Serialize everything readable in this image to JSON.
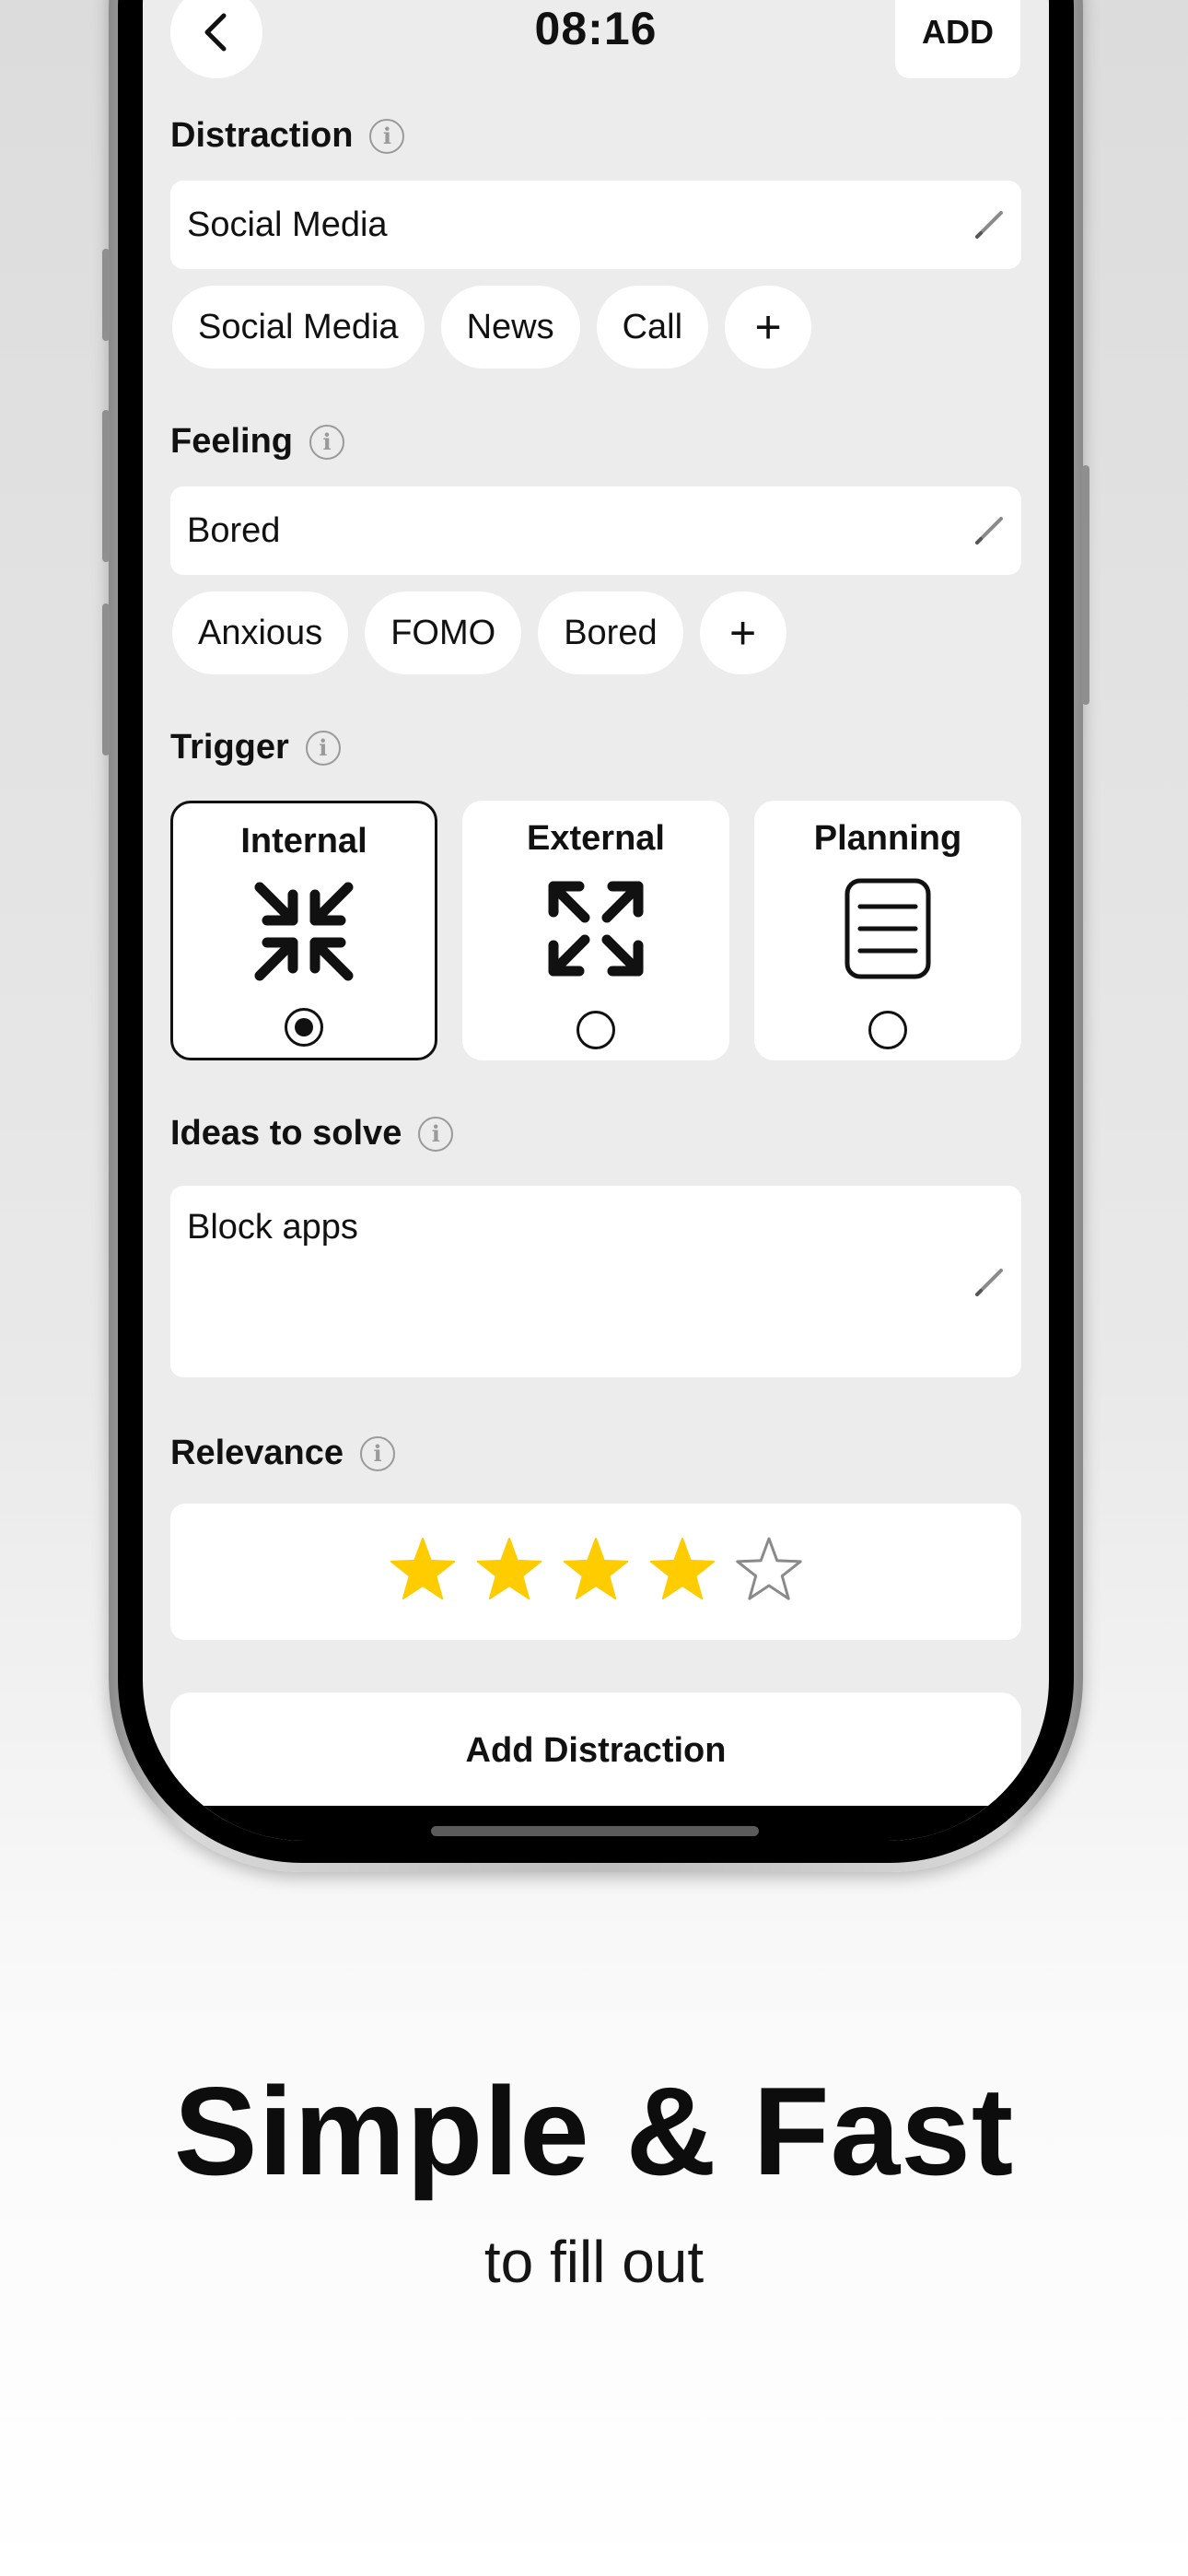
{
  "header": {
    "time": "08:16",
    "add_label": "ADD"
  },
  "distraction": {
    "label": "Distraction",
    "value": "Social Media",
    "chips": [
      "Social Media",
      "News",
      "Call"
    ],
    "add_chip": "+"
  },
  "feeling": {
    "label": "Feeling",
    "value": "Bored",
    "chips": [
      "Anxious",
      "FOMO",
      "Bored"
    ],
    "add_chip": "+"
  },
  "trigger": {
    "label": "Trigger",
    "options": [
      {
        "label": "Internal",
        "icon": "arrows-inward-icon",
        "selected": true
      },
      {
        "label": "External",
        "icon": "arrows-outward-icon",
        "selected": false
      },
      {
        "label": "Planning",
        "icon": "list-document-icon",
        "selected": false
      }
    ]
  },
  "ideas": {
    "label": "Ideas to solve",
    "value": "Block apps"
  },
  "relevance": {
    "label": "Relevance",
    "rating": 4,
    "max": 5,
    "star_color": "#FFCC00"
  },
  "submit_label": "Add Distraction",
  "marketing": {
    "headline": "Simple & Fast",
    "subline": "to fill out"
  }
}
